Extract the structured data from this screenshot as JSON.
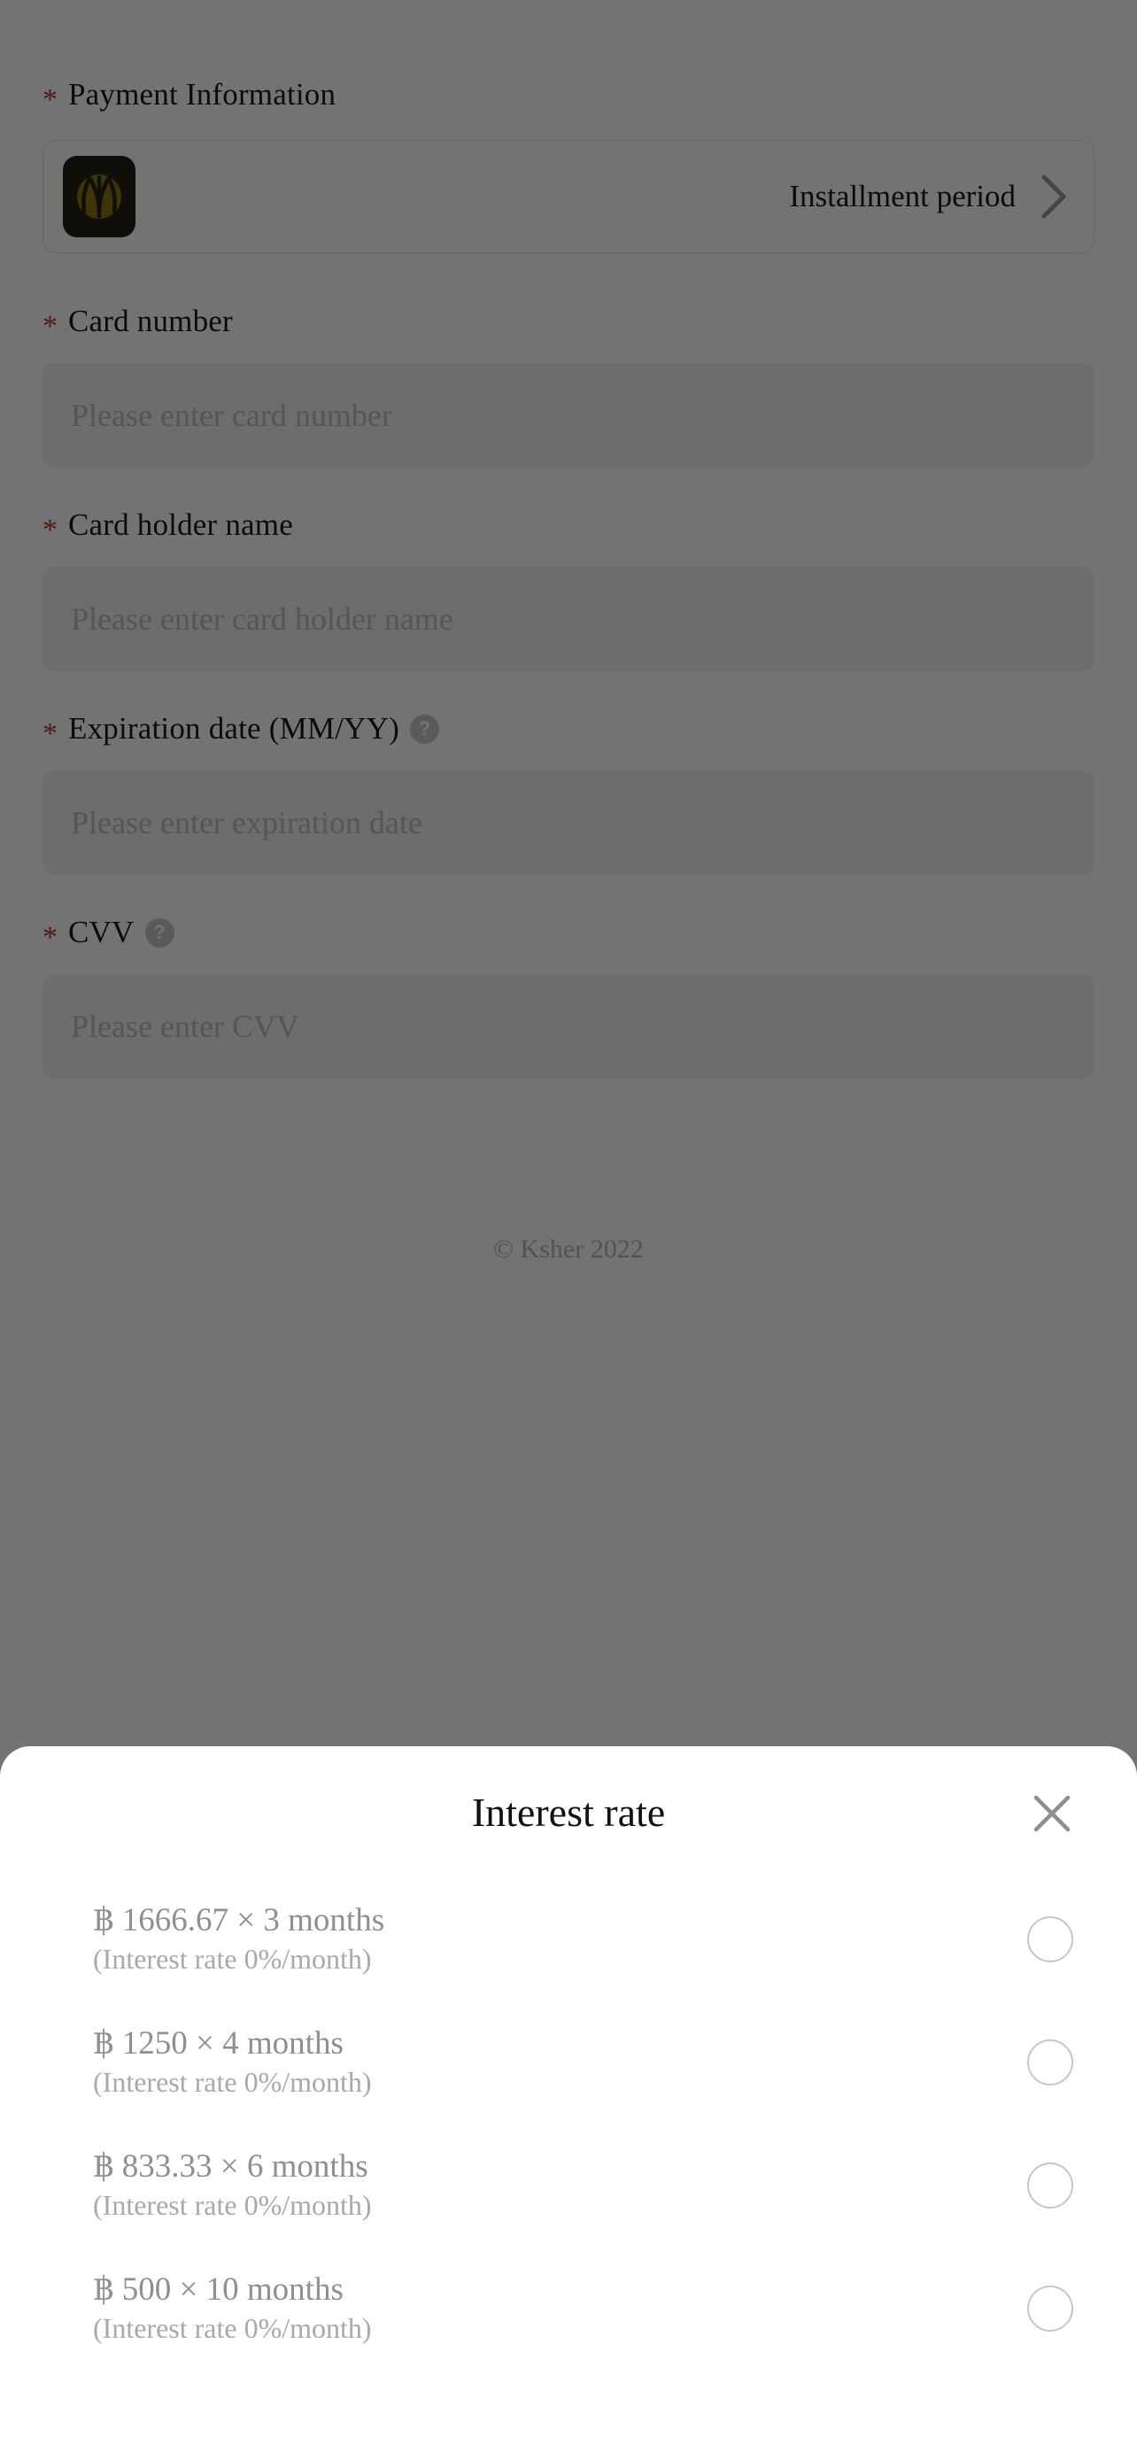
{
  "form": {
    "payment_information": {
      "required_mark": "*",
      "label": "Payment Information",
      "method": {
        "logo_name": "kasikorn-bank-logo",
        "label": "Installment period",
        "chevron_name": "chevron-right-icon"
      }
    },
    "fields": [
      {
        "required_mark": "*",
        "label": "Card number",
        "placeholder": "Please enter card number",
        "value": "",
        "has_help": false
      },
      {
        "required_mark": "*",
        "label": "Card holder name",
        "placeholder": "Please enter card holder name",
        "value": "",
        "has_help": false
      },
      {
        "required_mark": "*",
        "label": "Expiration date (MM/YY)",
        "placeholder": "Please enter expiration date",
        "value": "",
        "has_help": true,
        "help_glyph": "?"
      },
      {
        "required_mark": "*",
        "label": "CVV",
        "placeholder": "Please enter CVV",
        "value": "",
        "has_help": true,
        "help_glyph": "?"
      }
    ],
    "footer": "© Ksher 2022"
  },
  "sheet": {
    "title": "Interest rate",
    "close_icon": "close-icon",
    "options": [
      {
        "main": "฿ 1666.67 × 3 months",
        "sub": "(Interest rate 0%/month)",
        "amount": "1666.67",
        "months": "3",
        "rate": "0%/month",
        "selected": false
      },
      {
        "main": "฿ 1250 × 4 months",
        "sub": "(Interest rate 0%/month)",
        "amount": "1250",
        "months": "4",
        "rate": "0%/month",
        "selected": false
      },
      {
        "main": "฿ 833.33 × 6 months",
        "sub": "(Interest rate 0%/month)",
        "amount": "833.33",
        "months": "6",
        "rate": "0%/month",
        "selected": false
      },
      {
        "main": "฿ 500 × 10 months",
        "sub": "(Interest rate 0%/month)",
        "amount": "500",
        "months": "10",
        "rate": "0%/month",
        "selected": false
      }
    ]
  },
  "colors": {
    "required_star": "#b03a2e",
    "logo_background": "#231f16",
    "logo_emblem": "#8a7410",
    "overlay": "rgba(0,0,0,0.55)",
    "field_background": "#f2f2f2",
    "placeholder": "#bdbdbd",
    "option_text": "#8d8f96"
  }
}
